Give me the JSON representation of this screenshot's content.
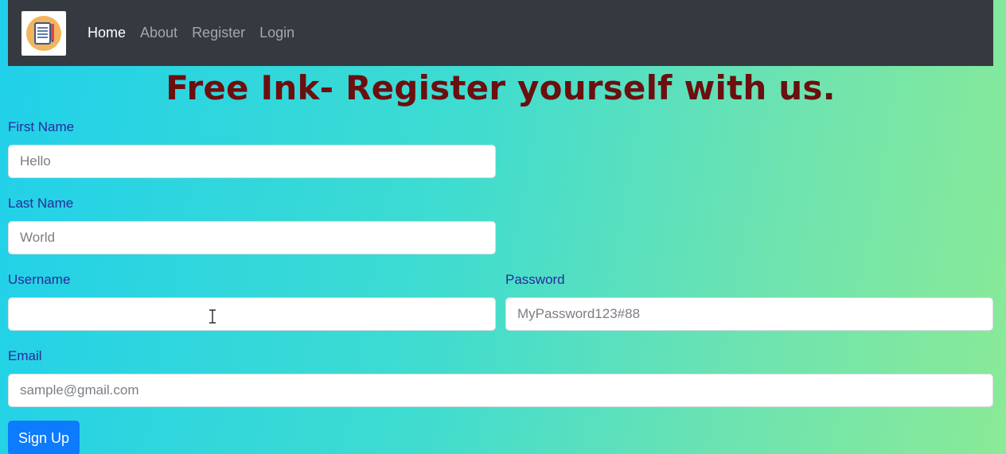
{
  "nav": {
    "logo_icon": "notepad-pencil-icon",
    "links": [
      "Home",
      "About",
      "Register",
      "Login"
    ],
    "active": "Home"
  },
  "page": {
    "title": "Free Ink- Register yourself with us."
  },
  "form": {
    "first_name_label": "First Name",
    "first_name_placeholder": "Hello",
    "last_name_label": "Last Name",
    "last_name_placeholder": "World",
    "username_label": "Username",
    "username_value": "",
    "password_label": "Password",
    "password_placeholder": "MyPassword123#88",
    "email_label": "Email",
    "email_placeholder": "sample@gmail.com",
    "submit_label": "Sign Up"
  },
  "colors": {
    "navbar": "#343a40",
    "title": "#6b0f0f",
    "labels": "#2a2a9c",
    "button": "#0d7bfd"
  }
}
